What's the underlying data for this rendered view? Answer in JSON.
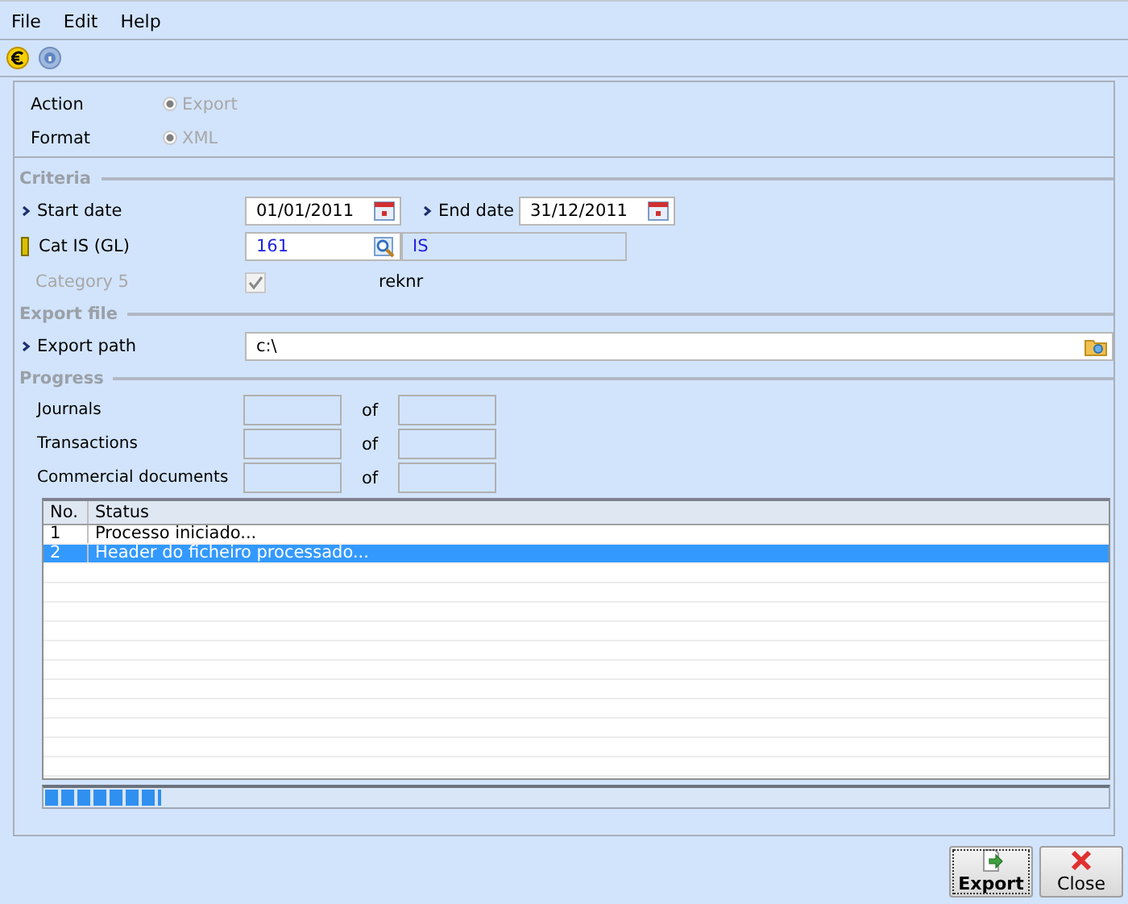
{
  "menu": [
    {
      "label": "File"
    },
    {
      "label": "Edit"
    },
    {
      "label": "Help"
    }
  ],
  "options": [
    {
      "label": "Action",
      "value": "Export",
      "selected": true,
      "disabled": true
    },
    {
      "label": "Format",
      "value": "XML",
      "selected": true,
      "disabled": true
    }
  ],
  "criteria": {
    "title": "Criteria",
    "start_label": "Start date",
    "start_value": "01/01/2011",
    "end_label": "End date",
    "end_value": "31/12/2011",
    "cat_label": "Cat IS (GL)",
    "cat_value": "161",
    "cat_desc": "IS",
    "cat5_label": "Category 5",
    "cat5_checked": true,
    "cat5_disabled": true,
    "cat5_desc": "reknr"
  },
  "export_file": {
    "title": "Export file",
    "label": "Export path",
    "value": "c:\\"
  },
  "progress": {
    "title": "Progress",
    "rows": [
      {
        "label": "Journals",
        "of": "of"
      },
      {
        "label": "Transactions",
        "of": "of"
      },
      {
        "label": "Commercial documents",
        "of": "of"
      }
    ]
  },
  "table": {
    "columns": [
      "No.",
      "Status"
    ],
    "rows": [
      {
        "no": "1",
        "status": "Processo iniciado...",
        "selected": false
      },
      {
        "no": "2",
        "status": "Header do ficheiro processado...",
        "selected": true
      }
    ]
  },
  "progress_bar": {
    "level": 0.11
  },
  "buttons": [
    {
      "label": "Export",
      "kind": "export",
      "focused": true
    },
    {
      "label": "Close",
      "kind": "close",
      "focused": false
    }
  ]
}
